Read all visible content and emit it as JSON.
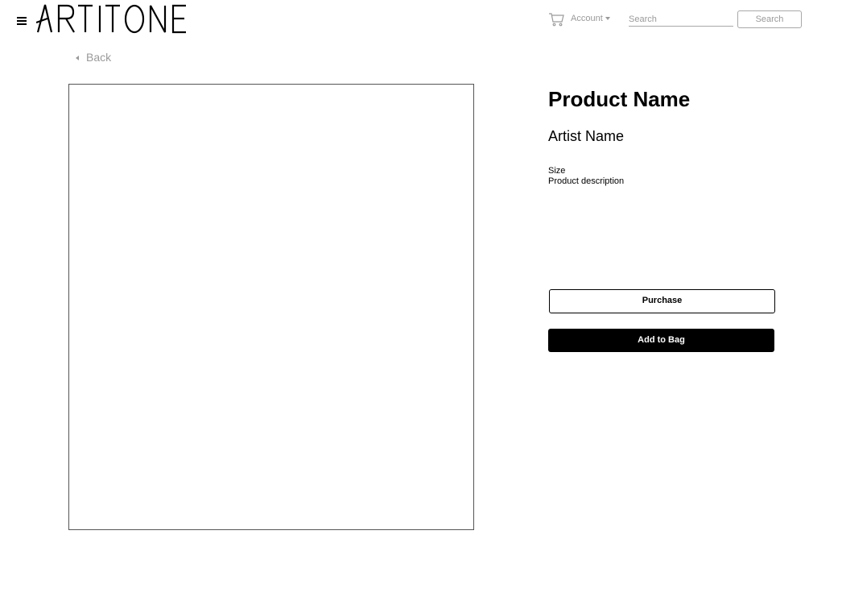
{
  "header": {
    "logo_text": "ARTITONE",
    "account_label": "Account",
    "search": {
      "placeholder": "Search",
      "value": "",
      "button_label": "Search"
    }
  },
  "nav": {
    "back_label": "Back"
  },
  "product": {
    "name": "Product Name",
    "artist": "Artist Name",
    "size_label": "Size",
    "description": "Product description",
    "purchase_label": "Purchase",
    "add_to_bag_label": "Add to Bag"
  },
  "colors": {
    "text": "#000000",
    "muted": "#9a9a9a",
    "border": "#a8a8a8",
    "primary_button_bg": "#000000",
    "background": "#ffffff"
  },
  "icons": {
    "menu": "hamburger-menu-icon",
    "cart": "shopping-cart-icon",
    "account_caret": "caret-down-icon",
    "back": "caret-left-icon"
  }
}
